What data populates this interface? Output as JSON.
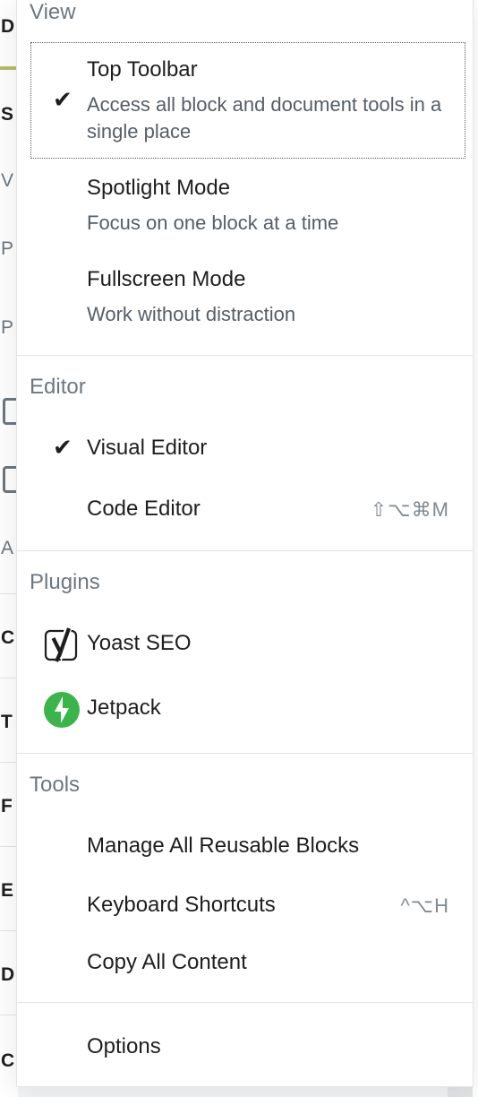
{
  "background": {
    "letters": [
      "D",
      "S",
      "V",
      "P",
      "P",
      "A",
      "C",
      "T",
      "F",
      "E",
      "D",
      "C"
    ]
  },
  "menu": {
    "view": {
      "label": "View",
      "items": [
        {
          "label": "Top Toolbar",
          "description": "Access all block and document tools in a single place",
          "checked": true,
          "focused": true
        },
        {
          "label": "Spotlight Mode",
          "description": "Focus on one block at a time",
          "checked": false
        },
        {
          "label": "Fullscreen Mode",
          "description": "Work without distraction",
          "checked": false
        }
      ]
    },
    "editor": {
      "label": "Editor",
      "items": [
        {
          "label": "Visual Editor",
          "checked": true,
          "shortcut": ""
        },
        {
          "label": "Code Editor",
          "checked": false,
          "shortcut": "⇧⌥⌘M"
        }
      ]
    },
    "plugins": {
      "label": "Plugins",
      "items": [
        {
          "label": "Yoast SEO",
          "icon": "yoast-icon"
        },
        {
          "label": "Jetpack",
          "icon": "jetpack-icon"
        }
      ]
    },
    "tools": {
      "label": "Tools",
      "items": [
        {
          "label": "Manage All Reusable Blocks",
          "shortcut": ""
        },
        {
          "label": "Keyboard Shortcuts",
          "shortcut": "^⌥H"
        },
        {
          "label": "Copy All Content",
          "shortcut": ""
        }
      ]
    },
    "options": {
      "label": "Options"
    },
    "check_glyph": "✔",
    "colors": {
      "jetpack_green": "#3ab54a",
      "group_label": "#6c7781",
      "divider": "#e2e4e7"
    }
  }
}
